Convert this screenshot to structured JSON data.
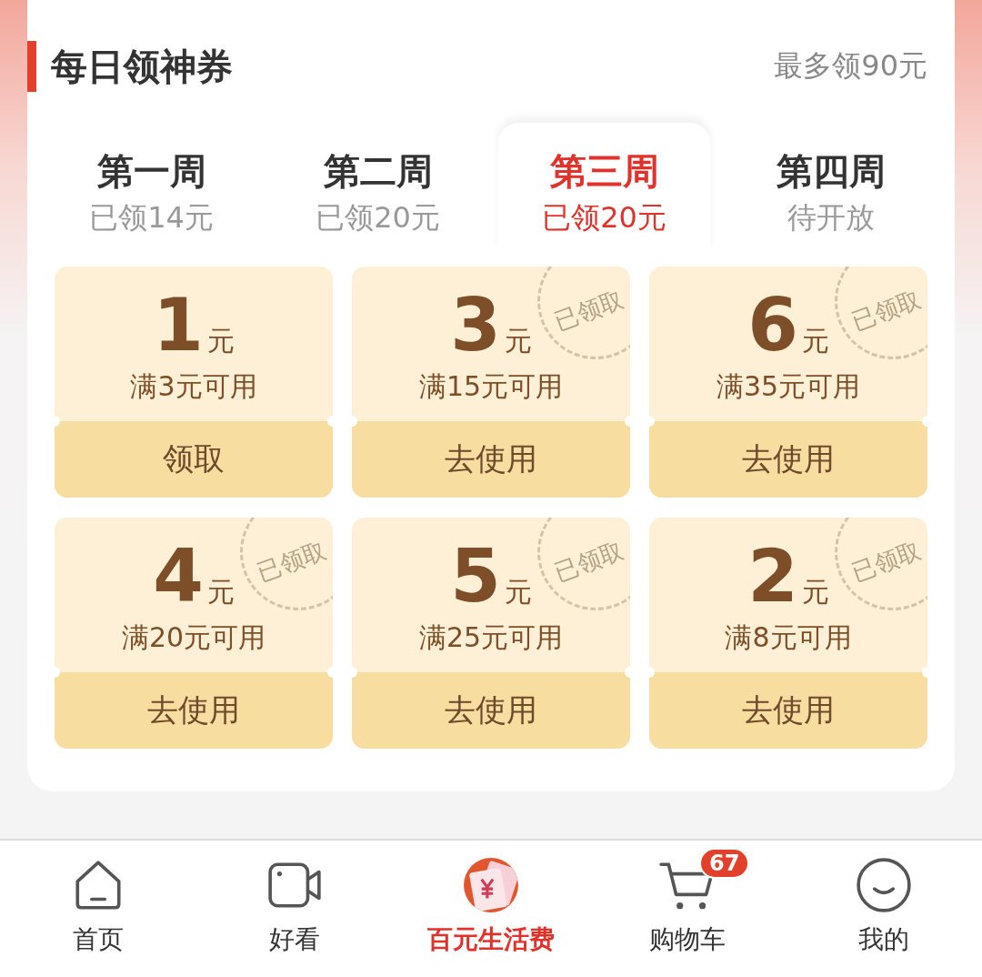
{
  "section": {
    "title": "每日领神券",
    "note": "最多领90元"
  },
  "tabs": [
    {
      "label": "第一周",
      "sub": "已领14元",
      "selected": false
    },
    {
      "label": "第二周",
      "sub": "已领20元",
      "selected": false
    },
    {
      "label": "第三周",
      "sub": "已领20元",
      "selected": true
    },
    {
      "label": "第四周",
      "sub": "待开放",
      "selected": false
    }
  ],
  "coupons": [
    {
      "amount": "1",
      "unit": "元",
      "condition": "满3元可用",
      "action": "领取"
    },
    {
      "amount": "3",
      "unit": "元",
      "condition": "满15元可用",
      "action": "去使用",
      "stamp": "已领取"
    },
    {
      "amount": "6",
      "unit": "元",
      "condition": "满35元可用",
      "action": "去使用",
      "stamp": "已领取"
    },
    {
      "amount": "4",
      "unit": "元",
      "condition": "满20元可用",
      "action": "去使用",
      "stamp": "已领取"
    },
    {
      "amount": "5",
      "unit": "元",
      "condition": "满25元可用",
      "action": "去使用",
      "stamp": "已领取"
    },
    {
      "amount": "2",
      "unit": "元",
      "condition": "满8元可用",
      "action": "去使用",
      "stamp": "已领取"
    }
  ],
  "nav": [
    {
      "kind": "home",
      "label": "首页",
      "selected": false
    },
    {
      "kind": "video",
      "label": "好看",
      "selected": false
    },
    {
      "kind": "money",
      "label": "百元生活费",
      "selected": true
    },
    {
      "kind": "cart",
      "label": "购物车",
      "selected": false,
      "badge": "67"
    },
    {
      "kind": "face",
      "label": "我的",
      "selected": false
    }
  ]
}
